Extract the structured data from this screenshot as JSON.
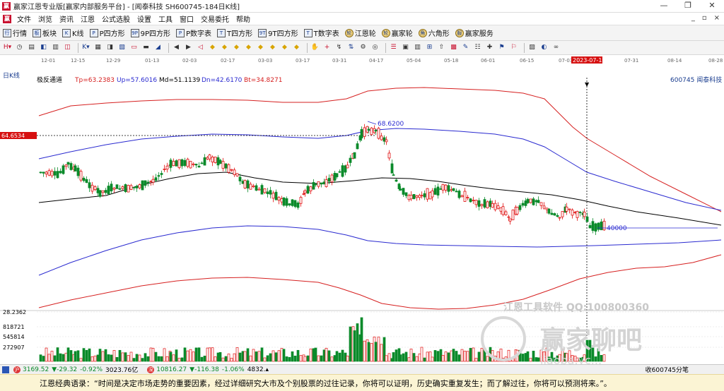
{
  "window": {
    "title": "赢家江恩专业版[赢家内部服务平台] - [闻泰科技  SH600745-184日K线]",
    "app_badge": "赢",
    "controls": [
      "—",
      "❐",
      "✕"
    ]
  },
  "menu": {
    "logo": "赢",
    "items": [
      "文件",
      "浏览",
      "资讯",
      "江恩",
      "公式选股",
      "设置",
      "工具",
      "窗口",
      "交易委托",
      "帮助"
    ],
    "mdi_controls": [
      "_",
      "▫",
      "×"
    ]
  },
  "toolbar1": [
    {
      "icon": "行",
      "label": "行情",
      "name": "market"
    },
    {
      "icon": "板",
      "label": "板块",
      "name": "sector"
    },
    {
      "icon": "K",
      "label": "K线",
      "name": "kline"
    },
    {
      "icon": "P",
      "label": "P四方形",
      "name": "p-square"
    },
    {
      "icon": "9P",
      "label": "9P四方形",
      "name": "9p-square"
    },
    {
      "icon": "P",
      "label": "P数字表",
      "name": "p-number-table"
    },
    {
      "icon": "T",
      "label": "T四方形",
      "name": "t-square"
    },
    {
      "icon": "9T",
      "label": "9T四方形",
      "name": "9t-square"
    },
    {
      "icon": "T",
      "label": "T数字表",
      "name": "t-number-table"
    },
    {
      "icon": "轮",
      "label": "江恩轮",
      "name": "gann-wheel",
      "round": true
    },
    {
      "icon": "轮",
      "label": "赢家轮",
      "name": "winner-wheel",
      "round": true
    },
    {
      "icon": "角",
      "label": "六角形",
      "name": "hexagon",
      "round": true
    },
    {
      "icon": "服",
      "label": "赢家服务",
      "name": "winner-service",
      "round": true
    }
  ],
  "toolbar2_icons": [
    "H▾",
    "◷",
    "▤",
    "◧",
    "▥",
    "◫",
    "K▾",
    "▦",
    "◨",
    "▧",
    "▭",
    "▬",
    "◢",
    "◀",
    "▶",
    "◁",
    "◆",
    "◆",
    "◆",
    "◆",
    "◆",
    "◆",
    "◆",
    "◆",
    "✋",
    "+",
    "↯",
    "⇅",
    "⚙",
    "◎",
    "☰",
    "▣",
    "▥",
    "⊞",
    "⇧",
    "▩",
    "✎",
    "☷",
    "✚",
    "⚑",
    "⚐",
    "▨",
    "◐",
    "∞"
  ],
  "chart": {
    "period_label": "日K线",
    "indicator": "极反通道",
    "tp": "Tp=63.2383",
    "up": "Up=57.6016",
    "md": "Md=51.1139",
    "dn": "Dn=42.6170",
    "bt": "Bt=34.8271",
    "stock_label": "600745 闻泰科技",
    "price_tag": "64.6534",
    "high_label": "68.6200",
    "low_label": "40000",
    "cursor_date": "2023-07-12",
    "dates": [
      "12-01",
      "12-15",
      "12-29",
      "01-13",
      "02-03",
      "02-17",
      "03-03",
      "03-17",
      "03-31",
      "04-17",
      "05-04",
      "05-18",
      "06-01",
      "06-15",
      "07-03",
      "07-31",
      "08-14",
      "08-28"
    ],
    "volume_labels": [
      "28.2362",
      "818721",
      "545814",
      "272907"
    ],
    "watermark_tools": "江恩工具软件  QQ:100800360",
    "watermark_brand": "赢家聊吧",
    "watermark_url": "jiaoba.yc..."
  },
  "status": {
    "sh_value": "3169.52",
    "sh_change": "▼-29.32",
    "sh_pct": "-0.92%",
    "sh_amount": "3023.76亿",
    "sz_value": "10816.27",
    "sz_change": "▼-116.38",
    "sz_pct": "-1.06%",
    "sz_amount": "4832.▴",
    "right_text": "收600745分笔"
  },
  "quote": "江恩经典语录：“时间是决定市场走势的重要因素，经过详细研究大市及个别股票的过往记录，你将可以证明，历史确实重复发生；而了解过往，你将可以预测将来。”。",
  "colors": {
    "band_red": "#d62020",
    "band_blue": "#2a2ad0",
    "mid_black": "#000000",
    "candle_up": "#e01010",
    "candle_down": "#0a8a2a"
  }
}
